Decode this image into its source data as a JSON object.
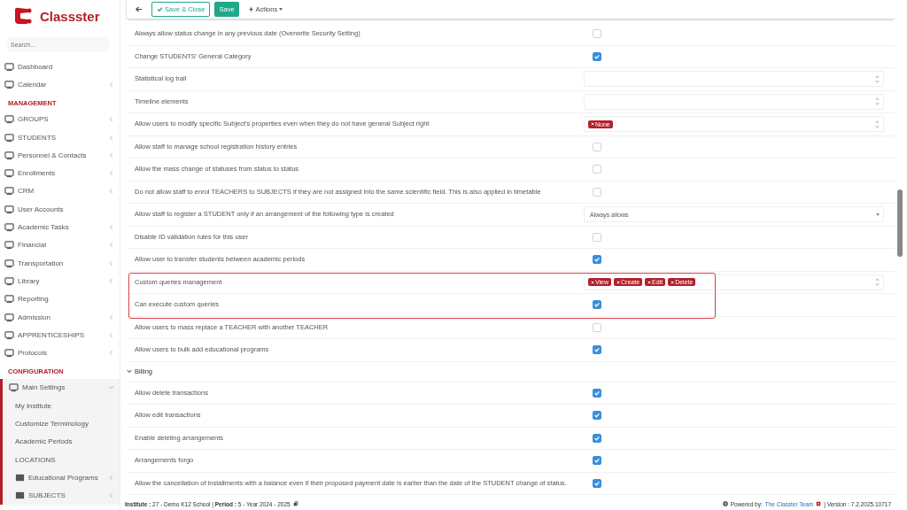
{
  "sidebar": {
    "logo": "Classster",
    "search_placeholder": "Search...",
    "sections": [
      {
        "items": [
          {
            "label": "Dashboard",
            "has_submenu": false
          },
          {
            "label": "Calendar",
            "has_submenu": true
          }
        ]
      },
      {
        "title": "MANAGEMENT",
        "items": [
          {
            "label": "GROUPS",
            "has_submenu": true
          },
          {
            "label": "STUDENTS",
            "has_submenu": true
          },
          {
            "label": "Personnel & Contacts",
            "has_submenu": true
          },
          {
            "label": "Enrollments",
            "has_submenu": true
          },
          {
            "label": "CRM",
            "has_submenu": true
          },
          {
            "label": "User Accounts",
            "has_submenu": false
          },
          {
            "label": "Academic Tasks",
            "has_submenu": true
          },
          {
            "label": "Financial",
            "has_submenu": true
          },
          {
            "label": "Transportation",
            "has_submenu": true
          },
          {
            "label": "Library",
            "has_submenu": true
          },
          {
            "label": "Reporting",
            "has_submenu": false
          },
          {
            "label": "Admission",
            "has_submenu": true
          },
          {
            "label": "APPRENTICESHIPS",
            "has_submenu": true
          },
          {
            "label": "Protocols",
            "has_submenu": true
          }
        ]
      },
      {
        "title": "CONFIGURATION",
        "items": [
          {
            "label": "Main Settings",
            "has_submenu": true,
            "expanded": true,
            "children": [
              {
                "label": "My Institute",
                "has_submenu": false
              },
              {
                "label": "Customize Terminology",
                "has_submenu": false
              },
              {
                "label": "Academic Periods",
                "has_submenu": false
              },
              {
                "label": "LOCATIONS",
                "has_submenu": false
              },
              {
                "label": "Educational Programs",
                "has_submenu": true
              },
              {
                "label": "SUBJECTS",
                "has_submenu": true
              }
            ]
          }
        ]
      }
    ]
  },
  "toolbar": {
    "save_close": "Save & Close",
    "save": "Save",
    "actions": "Actions"
  },
  "settings": [
    {
      "kind": "checkbox",
      "label": "Always allow status change in any previous date (Overwrite Security Setting)",
      "checked": false
    },
    {
      "kind": "checkbox",
      "label": "Change STUDENTS' General Category",
      "checked": true
    },
    {
      "kind": "multiselect",
      "label": "Statistical log trail"
    },
    {
      "kind": "multiselect",
      "label": "Timeline elements"
    },
    {
      "kind": "multiselect",
      "label": "Allow users to modify specific Subject's properties even when they do not have general Subject right",
      "tags": [
        "None"
      ]
    },
    {
      "kind": "checkbox",
      "label": "Allow staff to manage school registration history entries",
      "checked": false
    },
    {
      "kind": "checkbox",
      "label": "Allow the mass change of statuses from status to status",
      "checked": false
    },
    {
      "kind": "checkbox",
      "label": "Do not allow staff to enrol TEACHERS to SUBJECTS if they are not assigned into the same scientific field. This is also applied in timetable",
      "checked": false
    },
    {
      "kind": "select",
      "label": "Allow staff to register a STUDENT only if an arrangement of the following type is created",
      "value": "Always allows"
    },
    {
      "kind": "checkbox",
      "label": "Disable ID validation rules for this user",
      "checked": false
    },
    {
      "kind": "checkbox",
      "label": "Allow user to transfer students between academic periods",
      "checked": true
    },
    {
      "kind": "highlight",
      "rows": [
        {
          "kind": "multiselect",
          "label": "Custom queries management",
          "tags": [
            "View",
            "Create",
            "Edit",
            "Delete"
          ]
        },
        {
          "kind": "checkbox",
          "label": "Can execute custom queries",
          "checked": true
        }
      ]
    },
    {
      "kind": "checkbox",
      "label": "Allow users to mass replace a TEACHER with another TEACHER",
      "checked": false
    },
    {
      "kind": "checkbox",
      "label": "Allow users to bulk add educational programs",
      "checked": true
    },
    {
      "kind": "section",
      "label": "Billing",
      "expanded": true
    },
    {
      "kind": "checkbox",
      "label": "Allow delete transactions",
      "checked": true
    },
    {
      "kind": "checkbox",
      "label": "Allow edit transactions",
      "checked": true
    },
    {
      "kind": "checkbox",
      "label": "Enable deleting arrangements",
      "checked": true
    },
    {
      "kind": "checkbox",
      "label": "Arrangements forgo",
      "checked": true
    },
    {
      "kind": "checkbox",
      "label": "Allow the cancellation of installments with a balance even if their proposed payment date is earlier than the date of the STUDENT change of status.",
      "checked": true
    }
  ],
  "footer": {
    "institute": "**Institute :** 27 - Demo K12 School | **Period :** 5 - Year 2024 - 2025",
    "powered_by": "Powered by:",
    "team": "The Classter Team",
    "version": "| Version : 7.2.2025.10717"
  }
}
